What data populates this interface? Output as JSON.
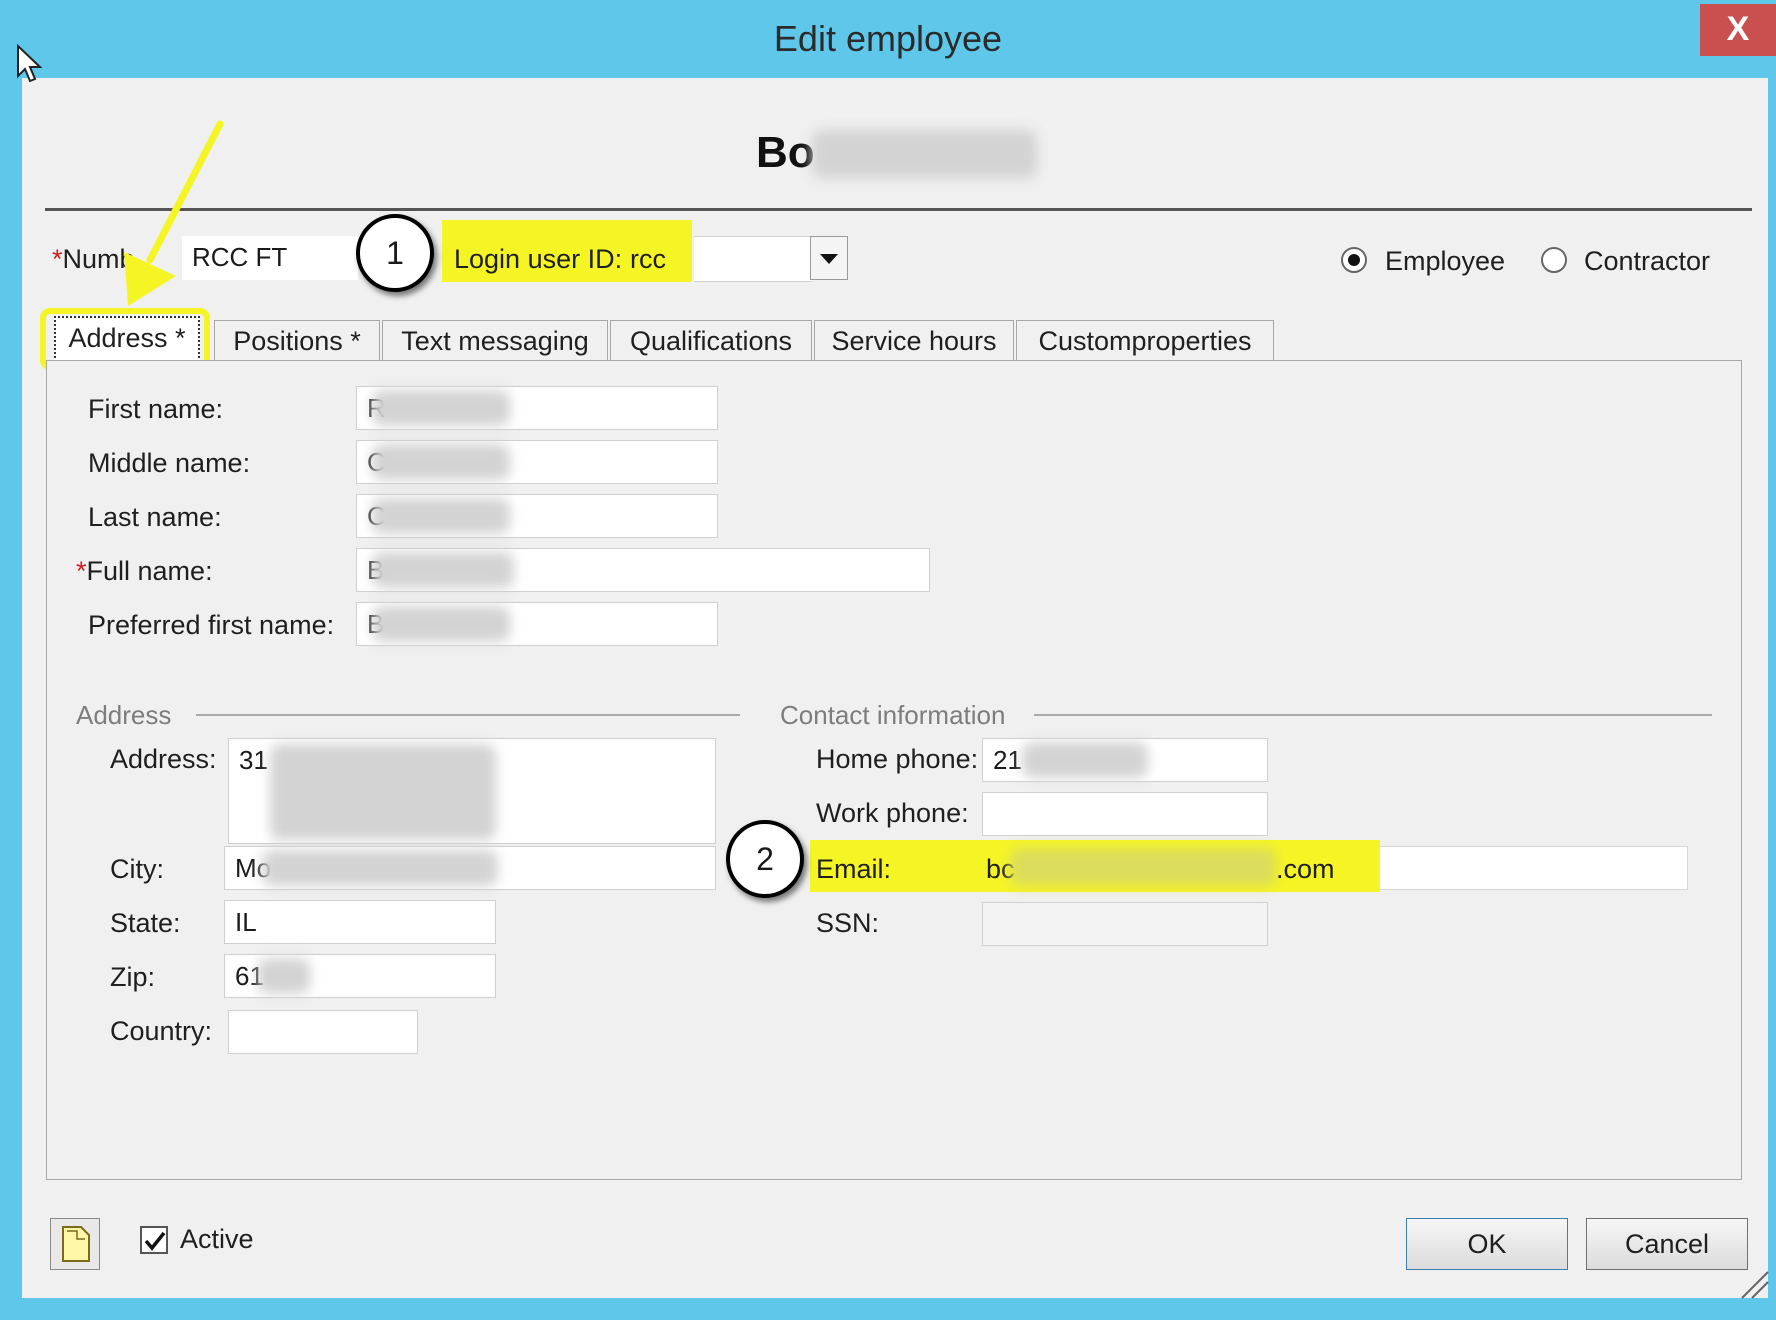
{
  "window": {
    "title": "Edit employee",
    "close_glyph": "X"
  },
  "header": {
    "employee_name_visible": "Bo"
  },
  "top_row": {
    "number_label": "Numb",
    "number_value": "RCC FT",
    "login_label": "Login user ID:",
    "login_value": "rcc",
    "employee_label": "Employee",
    "contractor_label": "Contractor",
    "employee_selected": true
  },
  "tabs": [
    {
      "label": "Address *",
      "active": true
    },
    {
      "label": "Positions *",
      "active": false
    },
    {
      "label": "Text messaging",
      "active": false
    },
    {
      "label": "Qualifications",
      "active": false
    },
    {
      "label": "Service hours",
      "active": false
    },
    {
      "label": "Customproperties",
      "active": false
    }
  ],
  "name_fields": {
    "first_name": {
      "label": "First name:",
      "value": "R"
    },
    "middle_name": {
      "label": "Middle name:",
      "value": "C"
    },
    "last_name": {
      "label": "Last name:",
      "value": "C"
    },
    "full_name": {
      "label": "Full name:",
      "value": "B"
    },
    "preferred_first_name": {
      "label": "Preferred first name:",
      "value": "B"
    }
  },
  "address_group": {
    "title": "Address",
    "address": {
      "label": "Address:",
      "value": "31"
    },
    "city": {
      "label": "City:",
      "value": "Mo"
    },
    "state": {
      "label": "State:",
      "value": "IL"
    },
    "zip": {
      "label": "Zip:",
      "value": "61"
    },
    "country": {
      "label": "Country:",
      "value": ""
    }
  },
  "contact_group": {
    "title": "Contact information",
    "home_phone": {
      "label": "Home phone:",
      "value": "21"
    },
    "work_phone": {
      "label": "Work phone:",
      "value": ""
    },
    "email": {
      "label": "Email:",
      "value_start": "bc",
      "value_end": ".com"
    },
    "ssn": {
      "label": "SSN:",
      "value": ""
    }
  },
  "footer": {
    "active_label": "Active",
    "active_checked": true,
    "ok_label": "OK",
    "cancel_label": "Cancel"
  },
  "annotations": {
    "callout_1": "1",
    "callout_2": "2",
    "highlight_color": "#f5f526",
    "arrow_color": "#f5f526"
  },
  "colors": {
    "titlebar": "#5fc8ea",
    "close_button": "#c9504f"
  }
}
